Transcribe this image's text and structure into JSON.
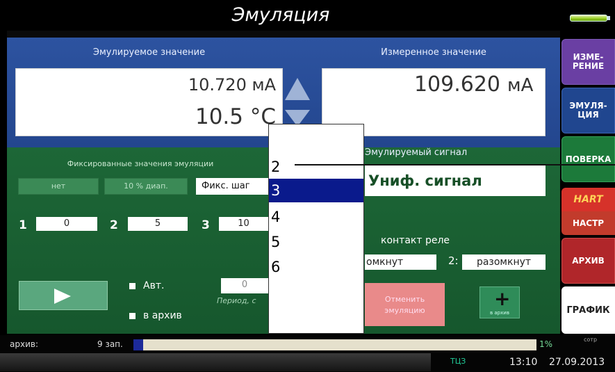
{
  "title": "Эмуляция",
  "emulated": {
    "header": "Эмулируемое значение",
    "value_ma": "10.720 мА",
    "value_c": "10.5 °С"
  },
  "measured": {
    "header": "Измеренное значение",
    "value": "109.620",
    "unit": "мА"
  },
  "fixed": {
    "header": "Фиксированные значения эмуляции",
    "btn_none": "нет",
    "btn_range": "10 % диап.",
    "btn_step": "Фикс. шаг",
    "labels": [
      "1",
      "2",
      "3"
    ],
    "values": [
      "0",
      "5",
      "10"
    ]
  },
  "signal": {
    "header": "Эмулируемый сигнал",
    "value": "Униф. сигнал"
  },
  "relay": {
    "header": "контакт реле",
    "contact1": "омкнут",
    "contact2_label": "2:",
    "contact2_value": "разомкнут"
  },
  "controls": {
    "auto_label": "Авт.",
    "archive_label": "в архив",
    "period_value": "0",
    "period_label": "Период, с",
    "cancel_label": "Отменить эмуляцию",
    "add_label": "в архив"
  },
  "dropdown": {
    "options": [
      "2",
      "3",
      "4",
      "5",
      "6"
    ],
    "selected_index": 1
  },
  "tabs": [
    {
      "label": "ИЗМЕ-РЕНИЕ",
      "color": "#6a3fa3"
    },
    {
      "label": "ЭМУЛЯ-ЦИЯ",
      "color": "#20468f"
    },
    {
      "label": "ПОВЕРКА",
      "color": "#1c7a3a"
    },
    {
      "label": "HART",
      "color": "#c23b2c"
    },
    {
      "label": "НАСТР",
      "color": "#c23b2c"
    },
    {
      "label": "АРХИВ",
      "color": "#b0262a"
    },
    {
      "label": "ГРАФИК",
      "color": "#ffffff"
    }
  ],
  "status": {
    "archive_label": "архив:",
    "records": "9 зап.",
    "percent": "1%",
    "percent_value": 1,
    "small_right": "сотр",
    "mode": "ТЦЗ",
    "time": "13:10",
    "date": "27.09.2013"
  }
}
